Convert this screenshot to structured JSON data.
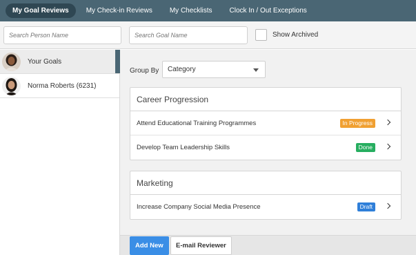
{
  "nav": {
    "tabs": [
      {
        "label": "My Goal Reviews",
        "active": true
      },
      {
        "label": "My Check-in Reviews",
        "active": false
      },
      {
        "label": "My Checklists",
        "active": false
      },
      {
        "label": "Clock In / Out Exceptions",
        "active": false
      }
    ]
  },
  "filters": {
    "person_placeholder": "Search Person Name",
    "goal_placeholder": "Search Goal Name",
    "show_archived_label": "Show Archived",
    "show_archived_checked": false
  },
  "people": [
    {
      "label": "Your Goals",
      "selected": true
    },
    {
      "label": "Norma Roberts (6231)",
      "selected": false
    }
  ],
  "group_by": {
    "label": "Group By",
    "value": "Category"
  },
  "groups": [
    {
      "title": "Career Progression",
      "goals": [
        {
          "name": "Attend Educational Training Programmes",
          "status": "In Progress",
          "status_color": "#f0a032"
        },
        {
          "name": "Develop Team Leadership Skills",
          "status": "Done",
          "status_color": "#27ae60"
        }
      ]
    },
    {
      "title": "Marketing",
      "goals": [
        {
          "name": "Increase Company Social Media Presence",
          "status": "Draft",
          "status_color": "#2f7fd9"
        }
      ]
    }
  ],
  "footer": {
    "add_new_label": "Add New",
    "email_reviewer_label": "E-mail Reviewer"
  },
  "colors": {
    "nav_bg": "#4a6674",
    "primary_button": "#3a8ee6"
  }
}
